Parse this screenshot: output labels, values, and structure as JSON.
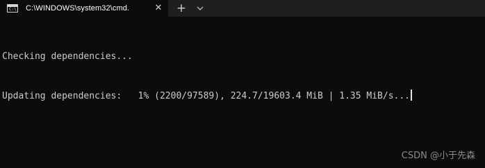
{
  "tab": {
    "icon_text": "C:\\",
    "title": "C:\\WINDOWS\\system32\\cmd.",
    "close_glyph": "✕"
  },
  "tabbar": {
    "new_tab_glyph": "+",
    "dropdown_icon": "chevron-down-icon"
  },
  "terminal": {
    "lines": [
      "Checking dependencies...",
      "Updating dependencies:   1% (2200/97589), 224.7/19603.4 MiB | 1.35 MiB/s..."
    ]
  },
  "watermark": {
    "text": "CSDN @小于先森"
  }
}
